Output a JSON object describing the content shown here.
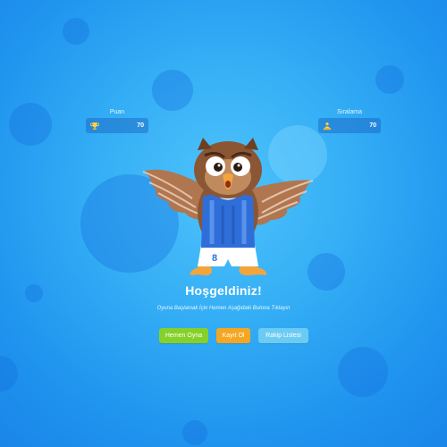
{
  "stats": {
    "points": {
      "label": "Puan",
      "value": "70",
      "icon": "trophy-icon"
    },
    "ranking": {
      "label": "Sıralama",
      "value": "70",
      "icon": "podium-icon"
    }
  },
  "welcome": {
    "title": "Hoşgeldiniz!",
    "subtitle": "Oyuna Başlamak İçin Hemen Aşağıdaki Butona Tıklayın"
  },
  "buttons": {
    "play": "Hemen Oyna",
    "register": "Kayıt Ol",
    "rivals": "Rakip Listesi"
  },
  "mascot": {
    "jersey_number": "8"
  },
  "colors": {
    "background": "#34aef5",
    "play_button": "#86d02a",
    "register_button": "#f5a623",
    "rivals_button": "#6ccbf3"
  }
}
